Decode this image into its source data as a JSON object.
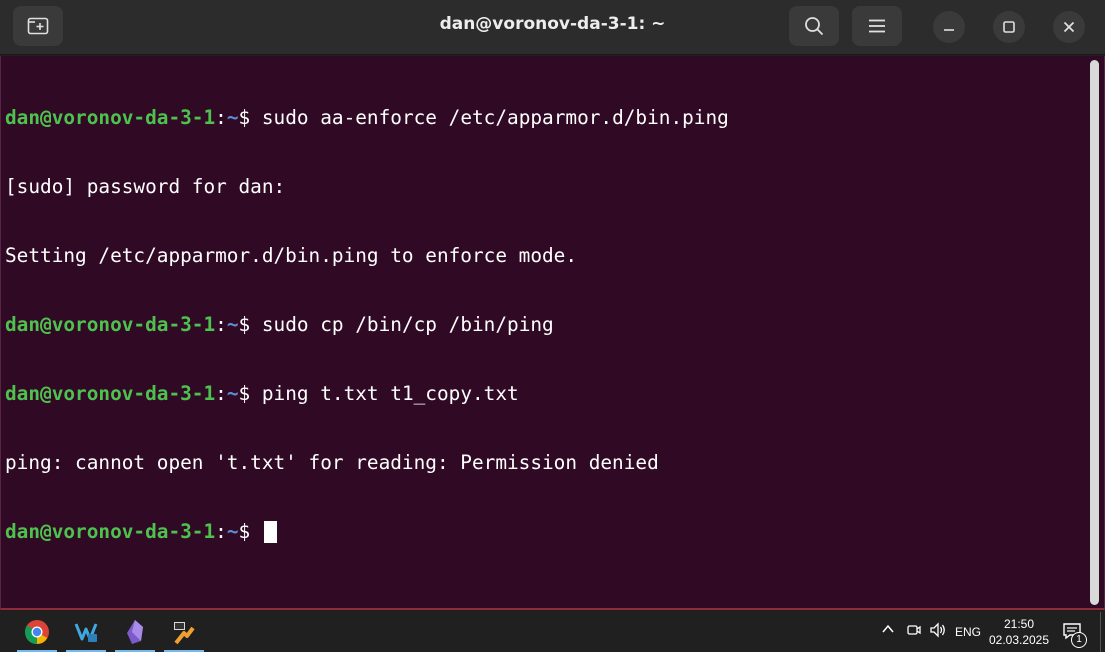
{
  "window": {
    "title": "dan@voronov-da-3-1: ~"
  },
  "terminal": {
    "lines": [
      {
        "type": "prompt",
        "user": "dan@voronov-da-3-1",
        "path": "~",
        "cmd": "$ sudo aa-enforce /etc/apparmor.d/bin.ping"
      },
      {
        "type": "output",
        "text": "[sudo] password for dan:"
      },
      {
        "type": "output",
        "text": "Setting /etc/apparmor.d/bin.ping to enforce mode."
      },
      {
        "type": "prompt",
        "user": "dan@voronov-da-3-1",
        "path": "~",
        "cmd": "$ sudo cp /bin/cp /bin/ping"
      },
      {
        "type": "prompt",
        "user": "dan@voronov-da-3-1",
        "path": "~",
        "cmd": "$ ping t.txt t1_copy.txt"
      },
      {
        "type": "output",
        "text": "ping: cannot open 't.txt' for reading: Permission denied"
      },
      {
        "type": "prompt",
        "user": "dan@voronov-da-3-1",
        "path": "~",
        "cmd": "$ "
      }
    ]
  },
  "taskbar": {
    "apps": [
      "chrome-icon",
      "vscode-icon",
      "obsidian-icon",
      "virtualbox-icon"
    ],
    "language": "ENG",
    "time": "21:50",
    "date": "02.03.2025",
    "notification_count": "1"
  },
  "colors": {
    "terminal_bg": "#300a24",
    "prompt_user": "#4ec24e",
    "prompt_path": "#5f8fd6",
    "titlebar_bg": "#2c2c2c"
  }
}
